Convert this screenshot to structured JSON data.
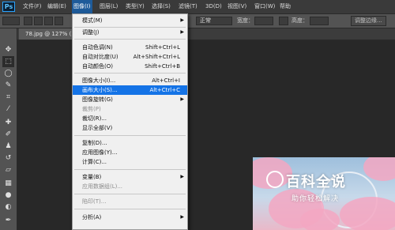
{
  "app": {
    "logo": "Ps"
  },
  "menubar": {
    "items": [
      "文件(F)",
      "编辑(E)",
      "图像(I)",
      "图层(L)",
      "类型(Y)",
      "选择(S)",
      "滤镜(T)",
      "3D(D)",
      "视图(V)",
      "窗口(W)",
      "帮助"
    ]
  },
  "options": {
    "blend_mode": "正常",
    "width_label": "宽度：",
    "height_label": "高度：",
    "refine_edge": "调整边缘..."
  },
  "document": {
    "tab": "78.jpg @ 127% (图"
  },
  "tools": [
    "move-tool",
    "marquee-tool",
    "lasso-tool",
    "quick-select-tool",
    "crop-tool",
    "eyedropper-tool",
    "healing-tool",
    "brush-tool",
    "stamp-tool",
    "history-brush-tool",
    "eraser-tool",
    "gradient-tool",
    "blur-tool",
    "dodge-tool",
    "pen-tool"
  ],
  "image_menu": {
    "items": [
      {
        "label": "模式(M)",
        "shortcut": "",
        "submenu": true,
        "disabled": false
      },
      {
        "label": "调整(J)",
        "shortcut": "",
        "submenu": true,
        "disabled": false
      },
      {
        "label": "自动色调(N)",
        "shortcut": "Shift+Ctrl+L",
        "submenu": false,
        "disabled": false
      },
      {
        "label": "自动对比度(U)",
        "shortcut": "Alt+Shift+Ctrl+L",
        "submenu": false,
        "disabled": false
      },
      {
        "label": "自动颜色(O)",
        "shortcut": "Shift+Ctrl+B",
        "submenu": false,
        "disabled": false
      },
      {
        "label": "图像大小(I)...",
        "shortcut": "Alt+Ctrl+I",
        "submenu": false,
        "disabled": false
      },
      {
        "label": "画布大小(S)...",
        "shortcut": "Alt+Ctrl+C",
        "submenu": false,
        "disabled": false,
        "highlighted": true
      },
      {
        "label": "图像旋转(G)",
        "shortcut": "",
        "submenu": true,
        "disabled": false
      },
      {
        "label": "裁剪(P)",
        "shortcut": "",
        "submenu": false,
        "disabled": true
      },
      {
        "label": "裁切(R)...",
        "shortcut": "",
        "submenu": false,
        "disabled": false
      },
      {
        "label": "显示全部(V)",
        "shortcut": "",
        "submenu": false,
        "disabled": false
      },
      {
        "label": "复制(D)...",
        "shortcut": "",
        "submenu": false,
        "disabled": false
      },
      {
        "label": "应用图像(Y)...",
        "shortcut": "",
        "submenu": false,
        "disabled": false
      },
      {
        "label": "计算(C)...",
        "shortcut": "",
        "submenu": false,
        "disabled": false
      },
      {
        "label": "变量(B)",
        "shortcut": "",
        "submenu": true,
        "disabled": false
      },
      {
        "label": "应用数据组(L)...",
        "shortcut": "",
        "submenu": false,
        "disabled": true
      },
      {
        "label": "陷印(T)...",
        "shortcut": "",
        "submenu": false,
        "disabled": true
      },
      {
        "label": "分析(A)",
        "shortcut": "",
        "submenu": true,
        "disabled": false
      }
    ]
  },
  "watermark": {
    "title": "百科全说",
    "subtitle": "助你轻松解决"
  },
  "colors": {
    "highlight": "#1473e6",
    "menu_bg": "#f0f0f0",
    "active_menu": "#1e5b9a",
    "panel": "#535353"
  }
}
